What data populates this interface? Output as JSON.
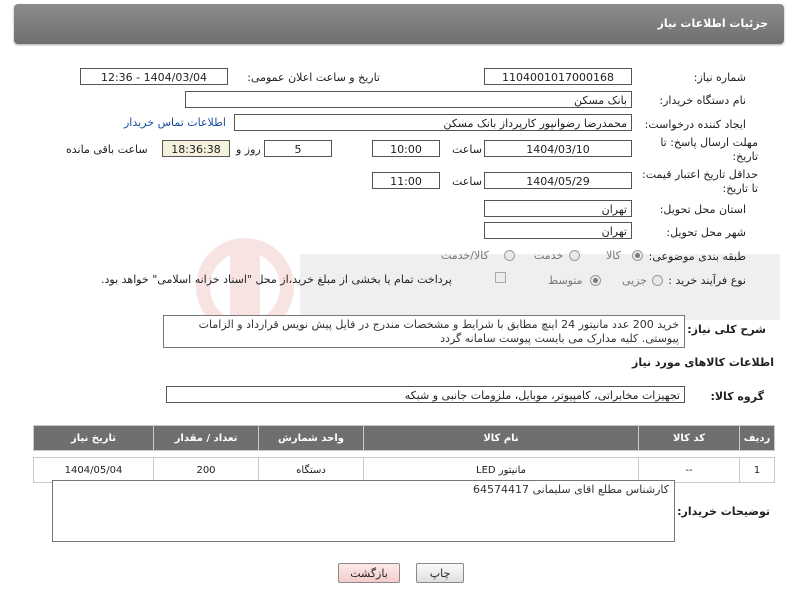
{
  "header": {
    "title": "جزئیات اطلاعات نیاز"
  },
  "need_number": {
    "label": "شماره نیاز:",
    "value": "1104001017000168"
  },
  "announce": {
    "label": "تاریخ و ساعت اعلان عمومی:",
    "value": "1404/03/04 - 12:36"
  },
  "buyer_org": {
    "label": "نام دستگاه خریدار:",
    "value": "بانک مسکن"
  },
  "requester": {
    "label": "ایجاد کننده درخواست:",
    "value": "محمدرضا رضوانپور کارپرداز بانک مسکن",
    "contact_link": "اطلاعات تماس خریدار"
  },
  "deadline": {
    "label": "مهلت ارسال پاسخ: تا تاریخ:",
    "date": "1404/03/10",
    "time_label": "ساعت",
    "time": "10:00",
    "days": "5",
    "days_label": "روز و",
    "remaining": "18:36:38",
    "remaining_label": "ساعت باقی مانده"
  },
  "price_validity": {
    "label": "حداقل تاریخ اعتبار قیمت: تا تاریخ:",
    "date": "1404/05/29",
    "time_label": "ساعت",
    "time": "11:00"
  },
  "province": {
    "label": "استان محل تحویل:",
    "value": "تهران"
  },
  "city": {
    "label": "شهر محل تحویل:",
    "value": "تهران"
  },
  "category": {
    "label": "طبقه بندی موضوعی:",
    "options": [
      "کالا",
      "خدمت",
      "کالا/خدمت"
    ],
    "selected": "کالا"
  },
  "process": {
    "label": "نوع فرآیند خرید :",
    "options": [
      "جزیی",
      "متوسط"
    ],
    "selected": "متوسط",
    "note": "پرداخت تمام یا بخشی از مبلغ خرید،از محل \"اسناد خزانه اسلامی\" خواهد بود."
  },
  "summary": {
    "label": "شرح کلی نیاز:",
    "text": "خرید 200 عدد مانیتور 24 اینچ مطابق با شرایط و مشخصات مندرج در فایل پیش نویس قرارداد و الزامات پیوستی. کلیه مدارک می بایست پیوست سامانه گردد"
  },
  "goods_info": {
    "title": "اطلاعات کالاهای مورد نیاز"
  },
  "goods_group": {
    "label": "گروه کالا:",
    "value": "تجهیزات مخابراتی، کامپیوتر، موبایل، ملزومات جانبی و شبکه"
  },
  "table": {
    "headers": [
      "ردیف",
      "کد کالا",
      "نام کالا",
      "واحد شمارش",
      "تعداد / مقدار",
      "تاریخ نیاز"
    ],
    "rows": [
      [
        "1",
        "--",
        "مانیتور LED",
        "دستگاه",
        "200",
        "1404/05/04"
      ]
    ]
  },
  "buyer_notes": {
    "label": "توضیحات خریدار:",
    "text": "کارشناس مطلع اقای سلیمانی 64574417"
  },
  "buttons": {
    "print": "چاپ",
    "back": "بازگشت"
  }
}
